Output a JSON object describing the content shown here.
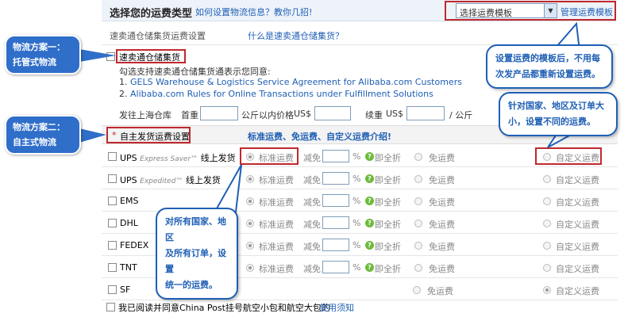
{
  "header": {
    "title": "选择您的运费类型",
    "help_link": "如何设置物流信息？教你几招!",
    "template_select": "选择运费模板",
    "manage_link": "管理运费模板"
  },
  "warehouse": {
    "section_label": "速卖通仓储集货运费设置",
    "what_link": "什么是速卖通仓储集货？",
    "checkbox_label": "速卖通仓储集货",
    "agree_text": "勾选支持速卖通仓储集货通表示您同意:",
    "agreement1": "GELS Warehouse & Logistics Service Agreement for Alibaba.com Customers",
    "agreement2": "Alibaba.com Rules for Online Transactions under Fulfillment Solutions",
    "ship_from": "发往上海仓库",
    "first_weight": "首重",
    "within_price": "公斤以内价格",
    "currency1": "US$",
    "extra_weight": "续重",
    "currency2": "US$",
    "per_kg": "/ 公斤"
  },
  "custom": {
    "required_mark": "*",
    "label": "自主发货运费设置",
    "intro_link": "标准运费、免运费、自定义运费介绍!"
  },
  "options": {
    "standard": "标准运费",
    "discount": "减免",
    "percent": "%",
    "all_off": "即全折",
    "free": "免运费",
    "custom": "自定义运费",
    "help_mark": "?"
  },
  "carriers": [
    {
      "name": "UPS",
      "sub": "Express Saver™",
      "tail": "线上发货"
    },
    {
      "name": "UPS",
      "sub": "Expedited™",
      "tail": "线上发货"
    },
    {
      "name": "EMS",
      "sub": "",
      "tail": ""
    },
    {
      "name": "DHL",
      "sub": "",
      "tail": ""
    },
    {
      "name": "FEDEX",
      "sub": "",
      "tail": ""
    },
    {
      "name": "TNT",
      "sub": "",
      "tail": ""
    },
    {
      "name": "SF",
      "sub": "",
      "tail": ""
    }
  ],
  "footer": {
    "agree": "我已阅读并同意China Post挂号航空小包和航空大包的",
    "notice_link": "使用须知"
  },
  "callouts": {
    "plan1_line1": "物流方案一：",
    "plan1_line2": "托管式物流",
    "plan2_line1": "物流方案二：",
    "plan2_line2": "自主式物流",
    "template_line1": "设置运费的模板后，不用每",
    "template_line2": "次发产品都重新设置运费。",
    "custom_line1": "针对国家、地区及订单大",
    "custom_line2": "小，设置不同的运费。",
    "unified_line1": "对所有国家、地区",
    "unified_line2": "及所有订单，设置",
    "unified_line3": "统一的运费。"
  }
}
